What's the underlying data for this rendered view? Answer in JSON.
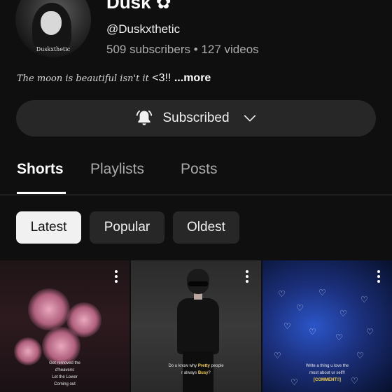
{
  "channel": {
    "name": "Dusk",
    "name_flourish": " ✿",
    "handle": "@Duskxthetic",
    "subscribers": "509 subscribers",
    "separator": "•",
    "videos": "127 videos",
    "avatar_text": "Duskxthetic",
    "description_fancy": "The moon is beautiful isn't it",
    "description_plain": " <3!! ",
    "description_more": "...more"
  },
  "subscribe_button": {
    "label": "Subscribed",
    "icon": "bell-icon",
    "dropdown_icon": "chevron-down-icon"
  },
  "tabs": [
    {
      "label": "Shorts",
      "active": true
    },
    {
      "label": "Playlists",
      "active": false
    },
    {
      "label": "Posts",
      "active": false
    }
  ],
  "chips": [
    {
      "label": "Latest",
      "selected": true
    },
    {
      "label": "Popular",
      "selected": false
    },
    {
      "label": "Oldest",
      "selected": false
    }
  ],
  "shorts": [
    {
      "caption_lines": [
        "Get removed the",
        "d'heavens",
        "Let the Lower",
        "Coming out"
      ]
    },
    {
      "caption_line1_a": "Do u know why ",
      "caption_line1_hl": "Pretty",
      "caption_line1_b": " people",
      "caption_line2_a": "r always ",
      "caption_line2_hl": "Busy",
      "caption_line2_b": "?"
    },
    {
      "caption_line1": "Write a thing u love the",
      "caption_line2": "most about ur self!!",
      "caption_line3": "[COMMENT!!]"
    }
  ],
  "colors": {
    "background": "#0f0f0f",
    "chip_bg": "#272727",
    "chip_selected_bg": "#f1f1f1",
    "text_secondary": "#aaaaaa"
  }
}
